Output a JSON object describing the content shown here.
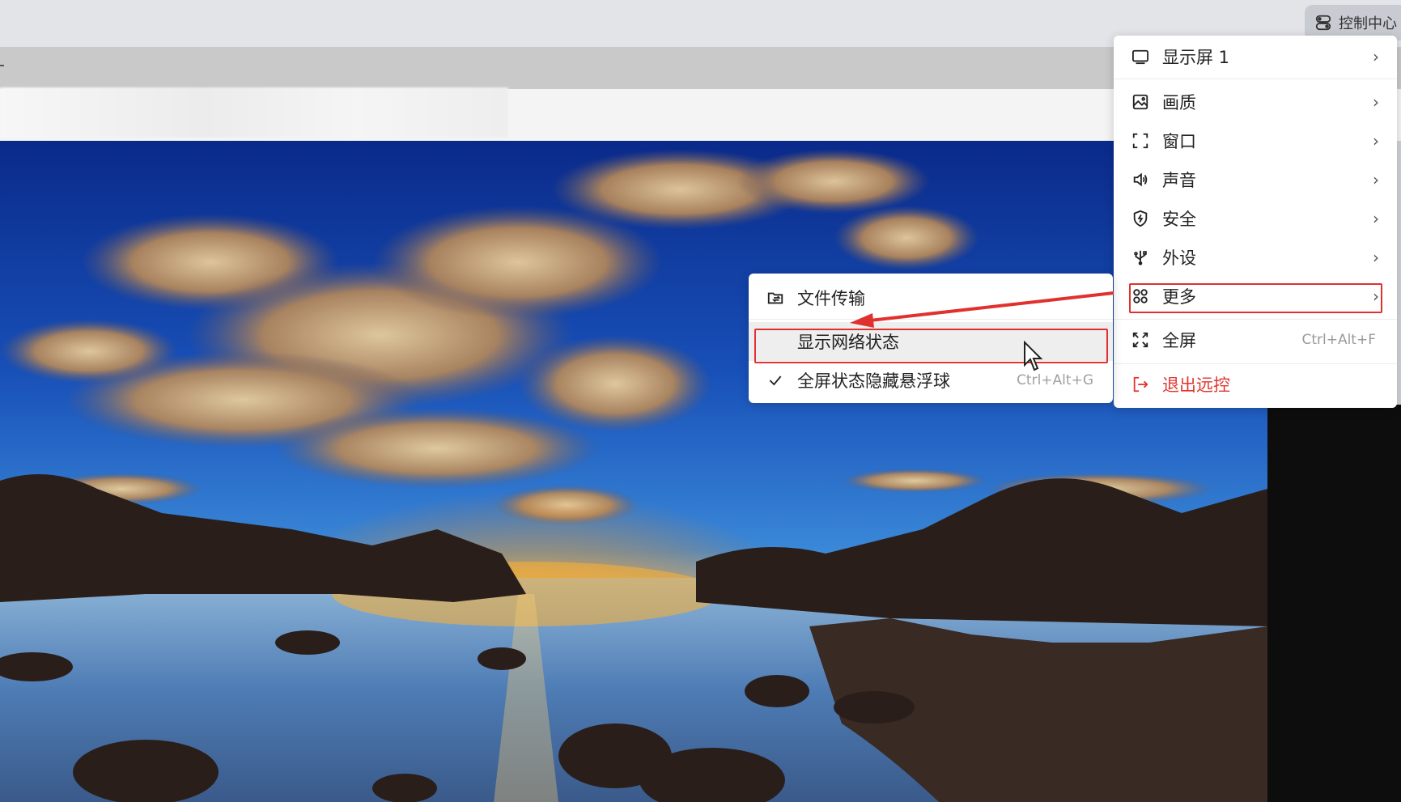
{
  "control_center": {
    "label": "控制中心"
  },
  "main_menu": {
    "items": [
      {
        "label": "显示屏 1",
        "icon": "monitor-icon",
        "has_submenu": true
      },
      {
        "label": "画质",
        "icon": "image-quality-icon",
        "has_submenu": true
      },
      {
        "label": "窗口",
        "icon": "window-frame-icon",
        "has_submenu": true
      },
      {
        "label": "声音",
        "icon": "speaker-icon",
        "has_submenu": true
      },
      {
        "label": "安全",
        "icon": "shield-icon",
        "has_submenu": true
      },
      {
        "label": "外设",
        "icon": "usb-icon",
        "has_submenu": true
      },
      {
        "label": "更多",
        "icon": "grid-icon",
        "has_submenu": true,
        "highlighted": true
      },
      {
        "label": "全屏",
        "icon": "fullscreen-icon",
        "shortcut": "Ctrl+Alt+F"
      },
      {
        "label": "退出远控",
        "icon": "exit-icon",
        "color": "#e2352f"
      }
    ],
    "chevron": "›"
  },
  "sub_menu": {
    "items": [
      {
        "label": "文件传输",
        "icon": "file-transfer-icon"
      },
      {
        "label": "显示网络状态",
        "highlighted": true
      },
      {
        "label": "全屏状态隐藏悬浮球",
        "icon": "check-icon",
        "checked": true,
        "shortcut": "Ctrl+Alt+G"
      }
    ]
  },
  "annotation": {
    "color": "#e0312f"
  }
}
